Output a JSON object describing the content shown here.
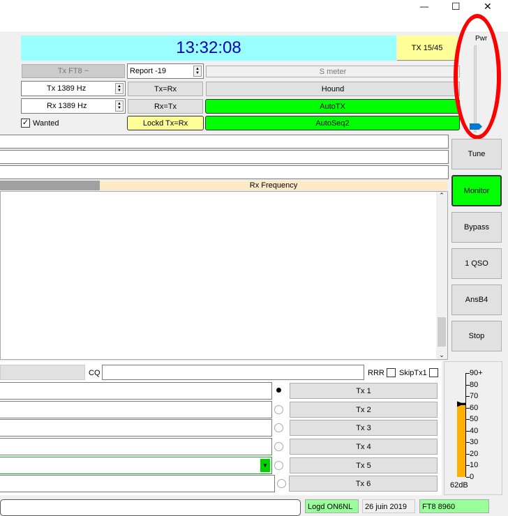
{
  "titlebar": {
    "minimize": "—",
    "maximize": "☐",
    "close": "✕"
  },
  "clock": "13:32:08",
  "tx_period": "TX 15/45",
  "tx_mode_button": "Tx FT8 ~",
  "report": "Report -19",
  "s_meter": "S meter",
  "tx_freq": "Tx  1389  Hz",
  "rx_freq": "Rx  1389  Hz",
  "tx_eq_rx": "Tx=Rx",
  "rx_eq_tx": "Rx=Tx",
  "hound": "Hound",
  "autotx": "AutoTX",
  "wanted": "Wanted",
  "lockd": "Lockd Tx=Rx",
  "autoseq": "AutoSeq2",
  "pwr": "Pwr",
  "rx_frequency_header": "Rx Frequency",
  "right_buttons": [
    "Tune",
    "Monitor",
    "Bypass",
    "1 QSO",
    "AnsB4",
    "Stop"
  ],
  "cq_label": "CQ",
  "rrr": "RRR",
  "skiptx1": "SkipTx1",
  "tx_buttons": [
    "Tx 1",
    "Tx 2",
    "Tx 3",
    "Tx 4",
    "Tx 5",
    "Tx 6"
  ],
  "meter": {
    "ticks": [
      "90+",
      "80",
      "70",
      "60",
      "50",
      "40",
      "30",
      "20",
      "10",
      "0"
    ],
    "level_db": 62,
    "label": "62dB",
    "color": "#ffb000"
  },
  "status": {
    "logged": "Logd ON6NL",
    "date": "26 juin 2019",
    "mode": "FT8  8960"
  },
  "colors": {
    "clock_bg": "#99ffff",
    "clock_text": "#0000c0",
    "yellow": "#ffff99",
    "green": "#00ff00",
    "status_green": "#99ff99",
    "annotation_red": "#ff0000"
  }
}
